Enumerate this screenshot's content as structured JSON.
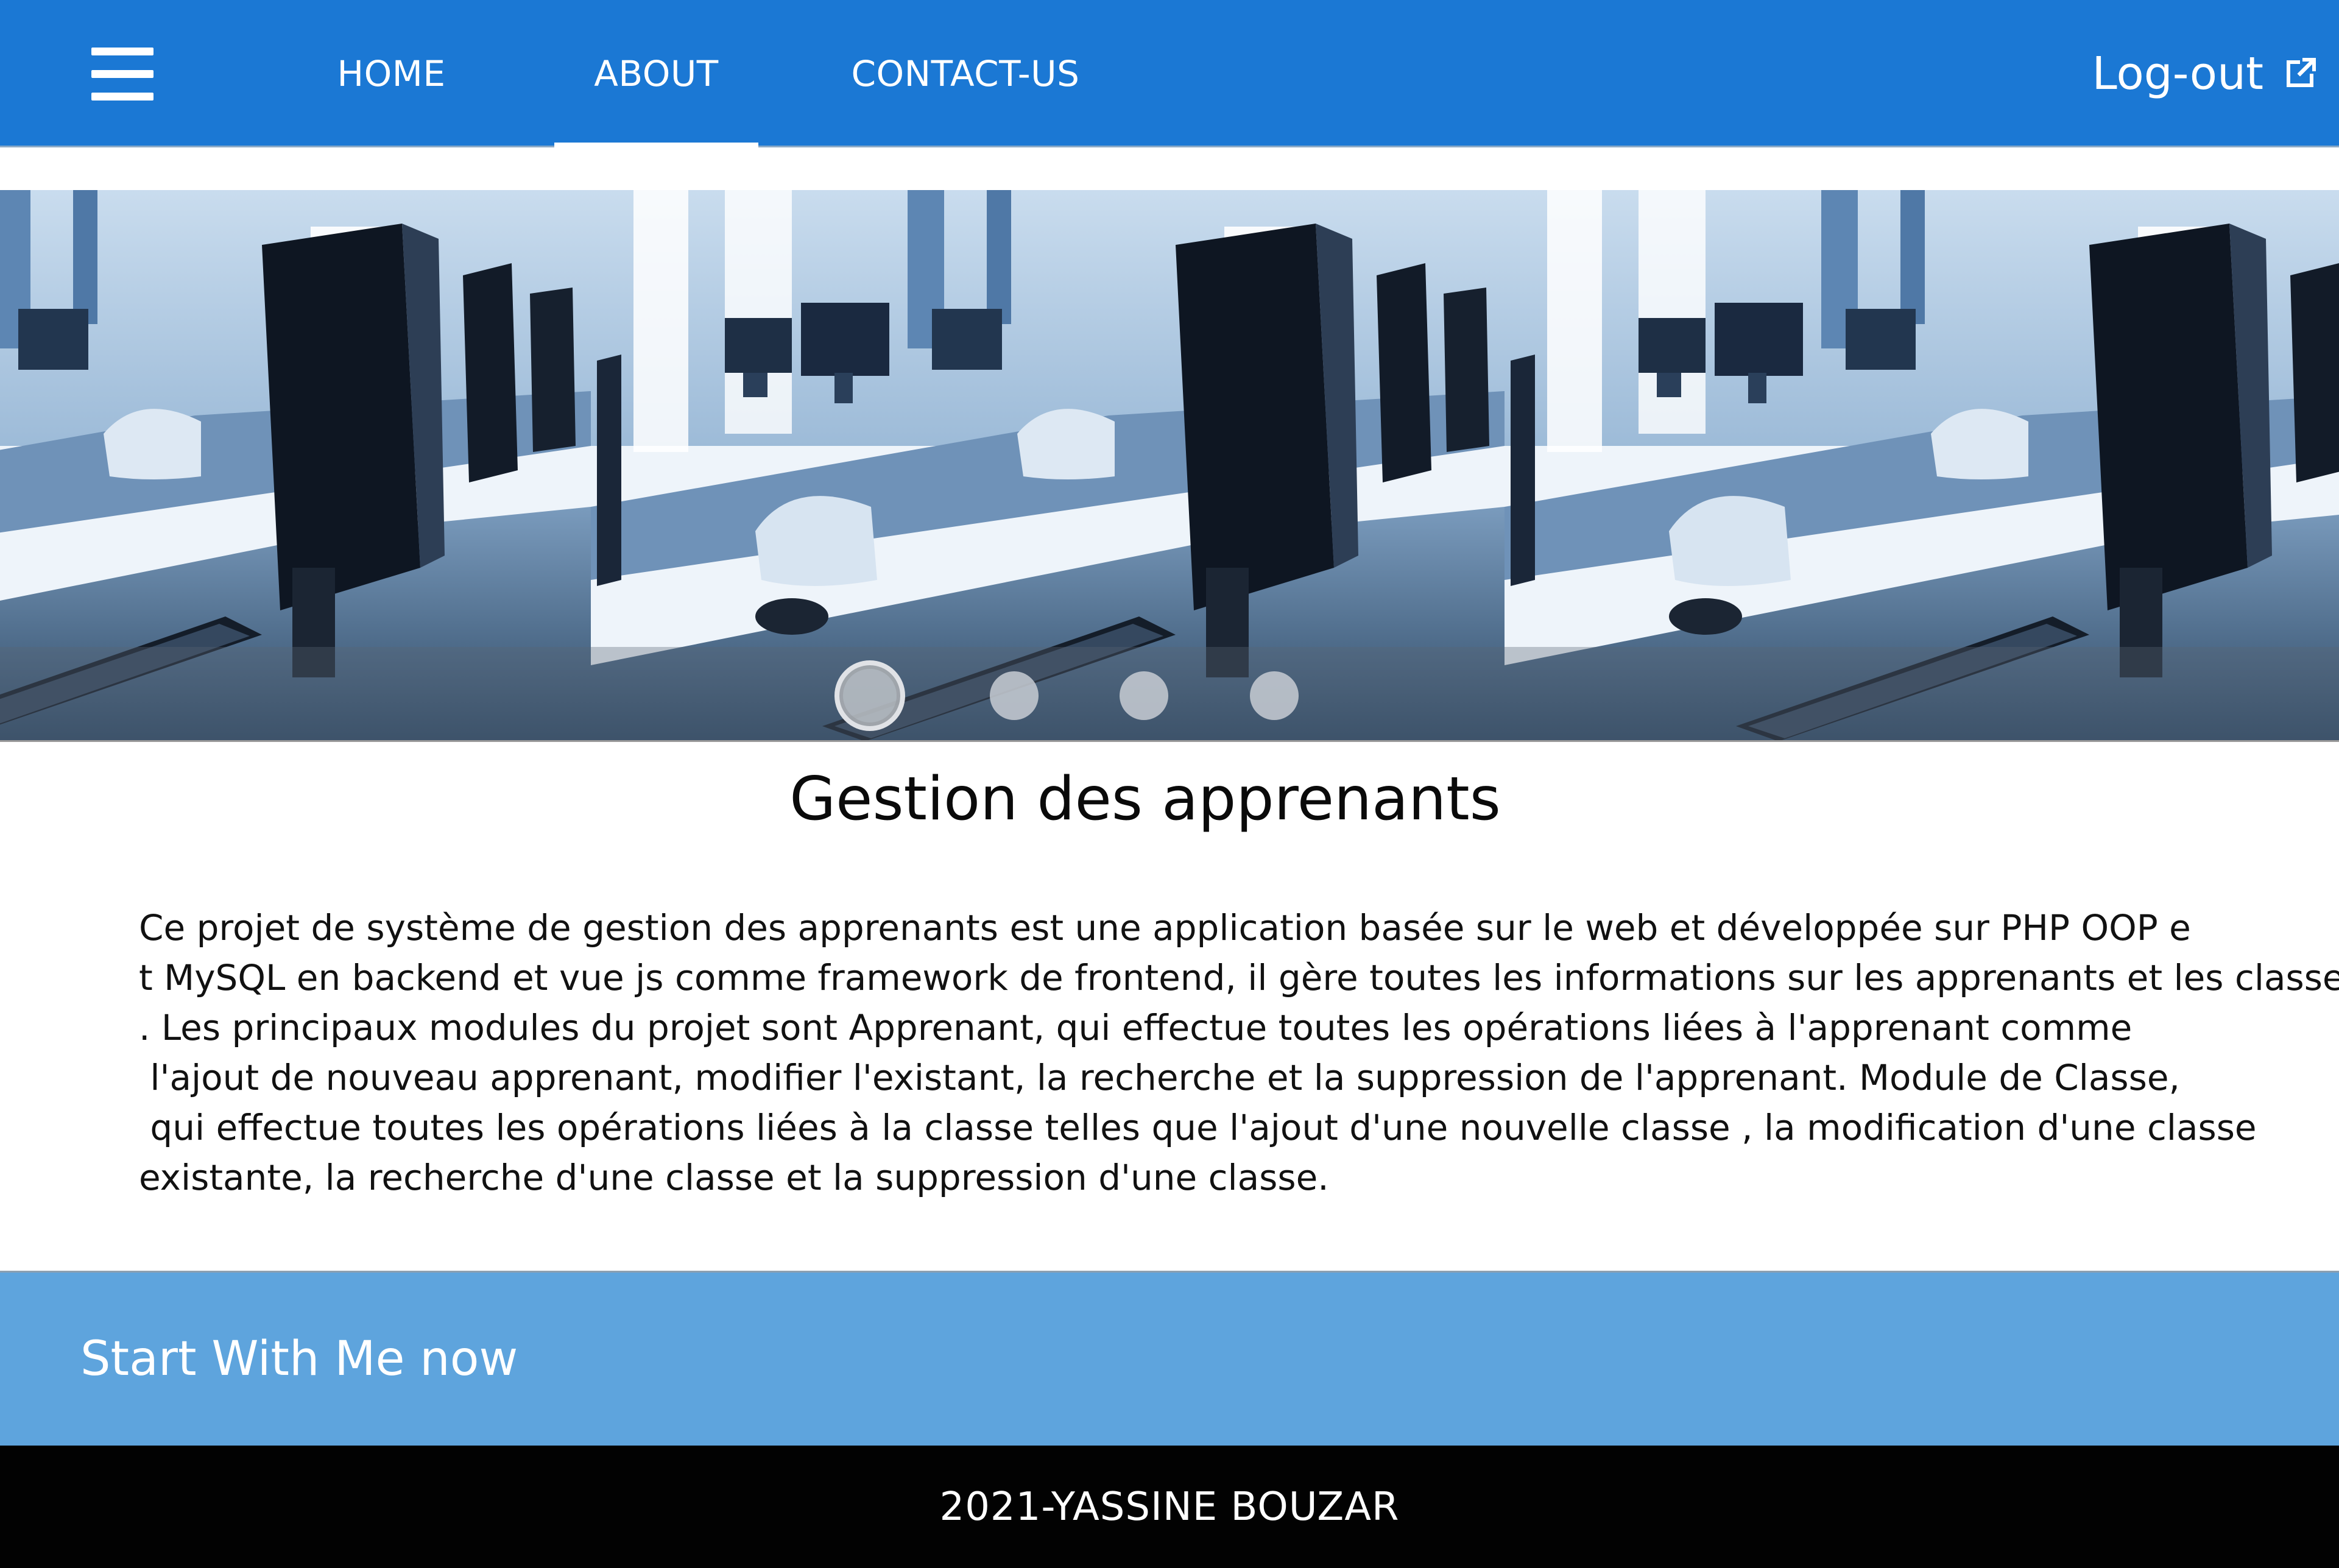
{
  "nav": {
    "menu_icon": "hamburger-menu-icon",
    "links": [
      {
        "label": "HOME"
      },
      {
        "label": "ABOUT",
        "active": true
      },
      {
        "label": "CONTACT-US"
      }
    ],
    "logout_label": "Log-out",
    "logout_icon": "external-link-icon",
    "background_color": "#1b78d4"
  },
  "carousel": {
    "image_subject": "computer-lab-photo",
    "slide_count": 4,
    "active_slide": 1
  },
  "content": {
    "title": "Gestion des apprenants",
    "description_lines": [
      "Ce projet de système de gestion des apprenants est une application basée sur le web et développée sur PHP OOP e",
      "t MySQL en backend et vue js comme framework de frontend, il gère toutes les informations sur les apprenants et les classes",
      ". Les principaux modules du projet sont Apprenant, qui effectue toutes les opérations liées à l'apprenant comme",
      " l'ajout de nouveau apprenant, modifier l'existant, la recherche et la suppression de l'apprenant. Module de Classe,",
      " qui effectue toutes les opérations liées à la classe telles que l'ajout d'une nouvelle classe , la modification d'une classe",
      "existante, la recherche d'une classe et la suppression d'une classe."
    ]
  },
  "cta": {
    "label": "Start With Me now",
    "background_color": "#5ea4dd"
  },
  "footer": {
    "text": "2021-YASSINE BOUZAR"
  }
}
